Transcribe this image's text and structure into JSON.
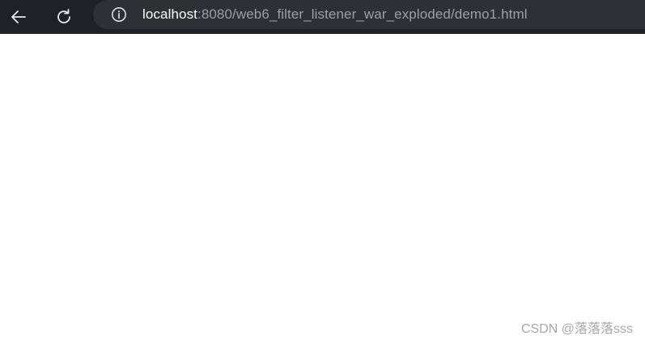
{
  "toolbar": {
    "back_icon": "arrow-left-icon",
    "reload_icon": "reload-icon",
    "info_icon": "info-circle-icon",
    "url_host": "localhost",
    "url_rest": ":8080/web6_filter_listener_war_exploded/demo1.html"
  },
  "watermark": {
    "text": "CSDN @落落落sss"
  },
  "colors": {
    "toolbar_bg": "#202124",
    "omnibox_bg": "#2f3033",
    "page_bg": "#ffffff"
  }
}
